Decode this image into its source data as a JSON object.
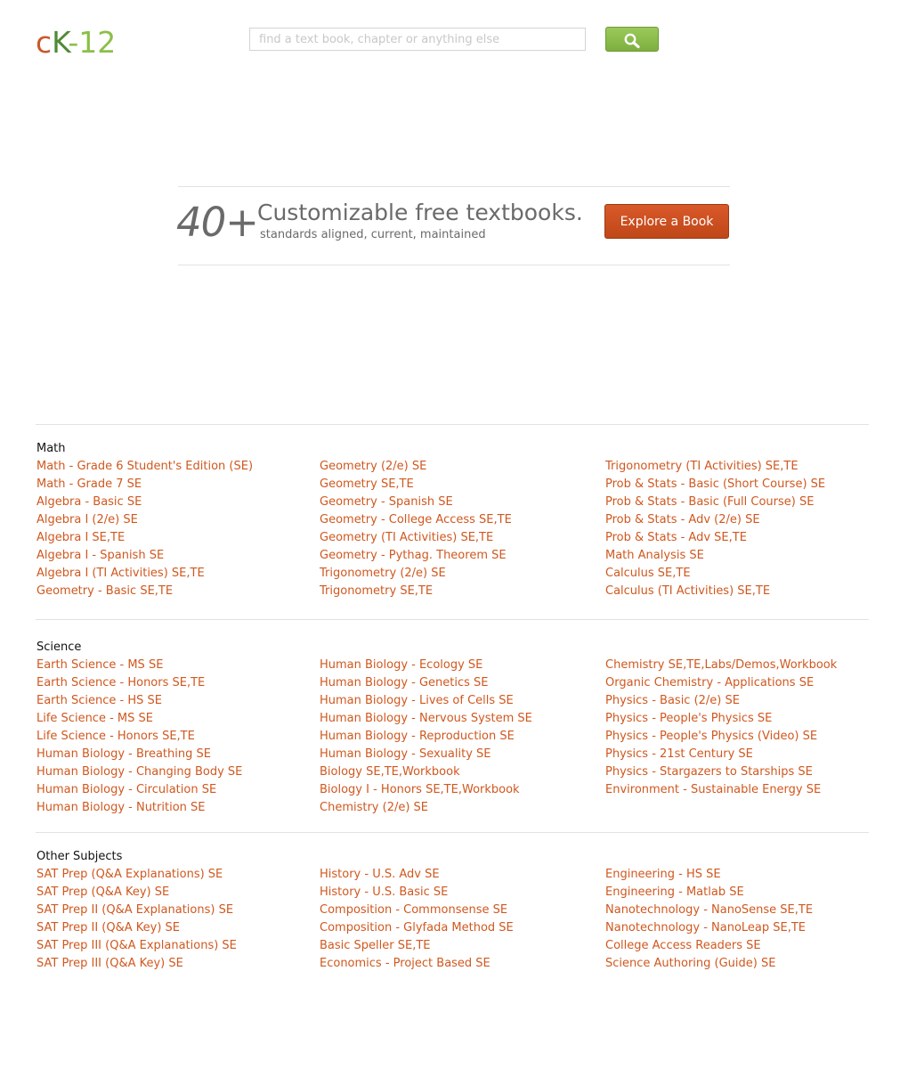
{
  "header": {
    "logo": {
      "c": "c",
      "k": "K",
      "dash": "-",
      "num": "12"
    },
    "search_placeholder": "find a text book, chapter or anything else",
    "search_icon": "magnifier-icon"
  },
  "promo": {
    "count": "40+",
    "title": "Customizable free textbooks.",
    "subtitle": "standards aligned, current, maintained",
    "button_label": "Explore a Book"
  },
  "colors": {
    "link": "#d0581f",
    "button_orange": "#cf5020",
    "button_green": "#8cbf4a",
    "logo_c": "#c9582b",
    "logo_k": "#4f8a35",
    "logo_12": "#8cbf4a"
  },
  "sections": [
    {
      "title": "Math",
      "columns": [
        [
          "Math - Grade 6 Student's Edition (SE)",
          "Math - Grade 7 SE",
          "Algebra - Basic SE",
          "Algebra I (2/e) SE",
          "Algebra I SE,TE",
          "Algebra I - Spanish SE",
          "Algebra I (TI Activities) SE,TE",
          "Geometry - Basic SE,TE"
        ],
        [
          "Geometry (2/e) SE",
          "Geometry SE,TE",
          "Geometry - Spanish SE",
          "Geometry - College Access SE,TE",
          "Geometry (TI Activities) SE,TE",
          "Geometry - Pythag. Theorem SE",
          "Trigonometry (2/e) SE",
          "Trigonometry SE,TE"
        ],
        [
          "Trigonometry (TI Activities) SE,TE",
          "Prob & Stats - Basic (Short Course) SE",
          "Prob & Stats - Basic (Full Course) SE",
          "Prob & Stats - Adv (2/e) SE",
          "Prob & Stats - Adv SE,TE",
          "Math Analysis SE",
          "Calculus SE,TE",
          "Calculus (TI Activities) SE,TE"
        ]
      ]
    },
    {
      "title": "Science",
      "columns": [
        [
          "Earth Science - MS SE",
          "Earth Science - Honors SE,TE",
          "Earth Science - HS SE",
          "Life Science - MS SE",
          "Life Science - Honors SE,TE",
          "Human Biology - Breathing SE",
          "Human Biology - Changing Body SE",
          "Human Biology - Circulation SE",
          "Human Biology - Nutrition SE"
        ],
        [
          "Human Biology - Ecology SE",
          "Human Biology - Genetics SE",
          "Human Biology - Lives of Cells SE",
          "Human Biology - Nervous System SE",
          "Human Biology - Reproduction SE",
          "Human Biology - Sexuality SE",
          "Biology SE,TE,Workbook",
          "Biology I - Honors SE,TE,Workbook",
          "Chemistry (2/e) SE"
        ],
        [
          "Chemistry SE,TE,Labs/Demos,Workbook",
          "Organic Chemistry - Applications SE",
          "Physics - Basic (2/e) SE",
          "Physics - People's Physics SE",
          "Physics - People's Physics (Video) SE",
          "Physics - 21st Century SE",
          "Physics - Stargazers to Starships SE",
          "Environment - Sustainable Energy SE"
        ]
      ]
    },
    {
      "title": "Other Subjects",
      "columns": [
        [
          "SAT Prep (Q&A Explanations) SE",
          "SAT Prep (Q&A Key) SE",
          "SAT Prep II (Q&A Explanations) SE",
          "SAT Prep II (Q&A Key) SE",
          "SAT Prep III (Q&A Explanations) SE",
          "SAT Prep III (Q&A Key) SE"
        ],
        [
          "History - U.S. Adv SE",
          "History - U.S. Basic SE",
          "Composition - Commonsense SE",
          "Composition - Glyfada Method SE",
          "Basic Speller SE,TE",
          "Economics - Project Based SE"
        ],
        [
          "Engineering - HS SE",
          "Engineering - Matlab SE",
          "Nanotechnology - NanoSense SE,TE",
          "Nanotechnology - NanoLeap SE,TE",
          "College Access Readers SE",
          "Science Authoring (Guide) SE"
        ]
      ]
    }
  ]
}
